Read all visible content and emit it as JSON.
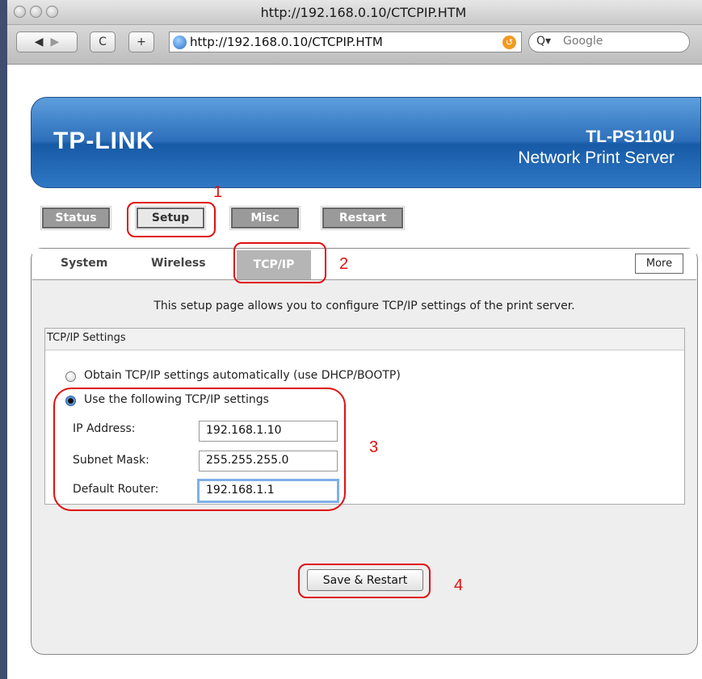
{
  "browser": {
    "title": "http://192.168.0.10/CTCPIP.HTM",
    "url": "http://192.168.0.10/CTCPIP.HTM",
    "search_placeholder": "Google",
    "reload_glyph": "C",
    "add_glyph": "+"
  },
  "banner": {
    "logo": "TP-LINK",
    "model": "TL-PS110U",
    "product": "Network Print Server"
  },
  "nav": {
    "items": [
      {
        "label": "Status"
      },
      {
        "label": "Setup"
      },
      {
        "label": "Misc"
      },
      {
        "label": "Restart"
      }
    ],
    "active": "Setup"
  },
  "subtabs": {
    "items": [
      {
        "label": "System"
      },
      {
        "label": "Wireless"
      },
      {
        "label": "TCP/IP"
      }
    ],
    "active": "TCP/IP",
    "more_label": "More"
  },
  "page": {
    "intro": "This setup page allows you to configure TCP/IP settings of the print server.",
    "section_title": "TCP/IP Settings",
    "radio_auto": "Obtain TCP/IP settings automatically (use DHCP/BOOTP)",
    "radio_manual": "Use the following TCP/IP settings",
    "selected_mode": "manual",
    "fields": [
      {
        "label": "IP Address:",
        "value": "192.168.1.10"
      },
      {
        "label": "Subnet Mask:",
        "value": "255.255.255.0"
      },
      {
        "label": "Default Router:",
        "value": "192.168.1.1"
      }
    ],
    "save_label": "Save & Restart"
  },
  "annotations": [
    "1",
    "2",
    "3",
    "4"
  ],
  "colors": {
    "annotation_red": "#e01010",
    "banner_blue": "#2d6fba",
    "nav_gray": "#9a9a9a"
  }
}
